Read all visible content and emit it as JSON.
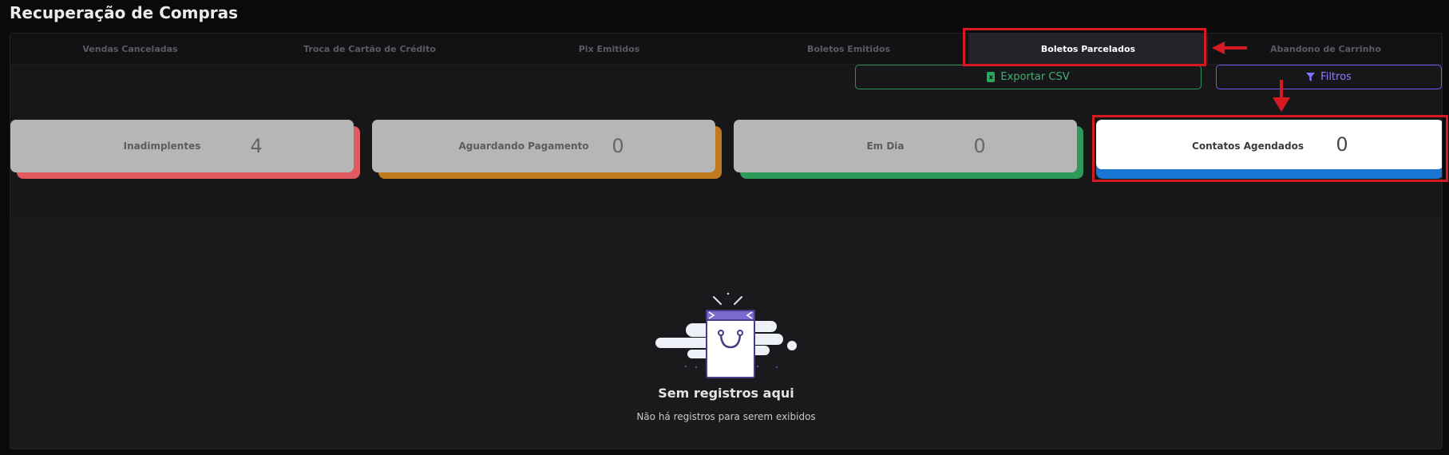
{
  "page": {
    "title": "Recuperação de Compras"
  },
  "tabs": [
    {
      "label": "Vendas Canceladas",
      "active": false
    },
    {
      "label": "Troca de Cartão de Crédito",
      "active": false
    },
    {
      "label": "Pix Emitidos",
      "active": false
    },
    {
      "label": "Boletos Emitidos",
      "active": false
    },
    {
      "label": "Boletos Parcelados",
      "active": true
    },
    {
      "label": "Abandono de Carrinho",
      "active": false
    }
  ],
  "toolbar": {
    "export_label": "Exportar CSV",
    "export_icon": "csv-file-icon",
    "filter_label": "Filtros",
    "filter_icon": "funnel-icon"
  },
  "stats": [
    {
      "label": "Inadimplentes",
      "value": "4",
      "accent": "#e05a5f"
    },
    {
      "label": "Aguardando Pagamento",
      "value": "0",
      "accent": "#c07a1e"
    },
    {
      "label": "Em Dia",
      "value": "0",
      "accent": "#2d9a5a"
    },
    {
      "label": "Contatos Agendados",
      "value": "0",
      "accent": "#1976d2",
      "active": true
    }
  ],
  "empty_state": {
    "icon": "shopping-bag-icon",
    "title": "Sem registros aqui",
    "subtitle": "Não há registros para serem exibidos"
  },
  "colors": {
    "background": "#0a0a0b",
    "panel": "#17171a",
    "csv_green": "#3fb271",
    "filter_purple": "#8a7dff",
    "annotation_red": "#d61a1f"
  }
}
